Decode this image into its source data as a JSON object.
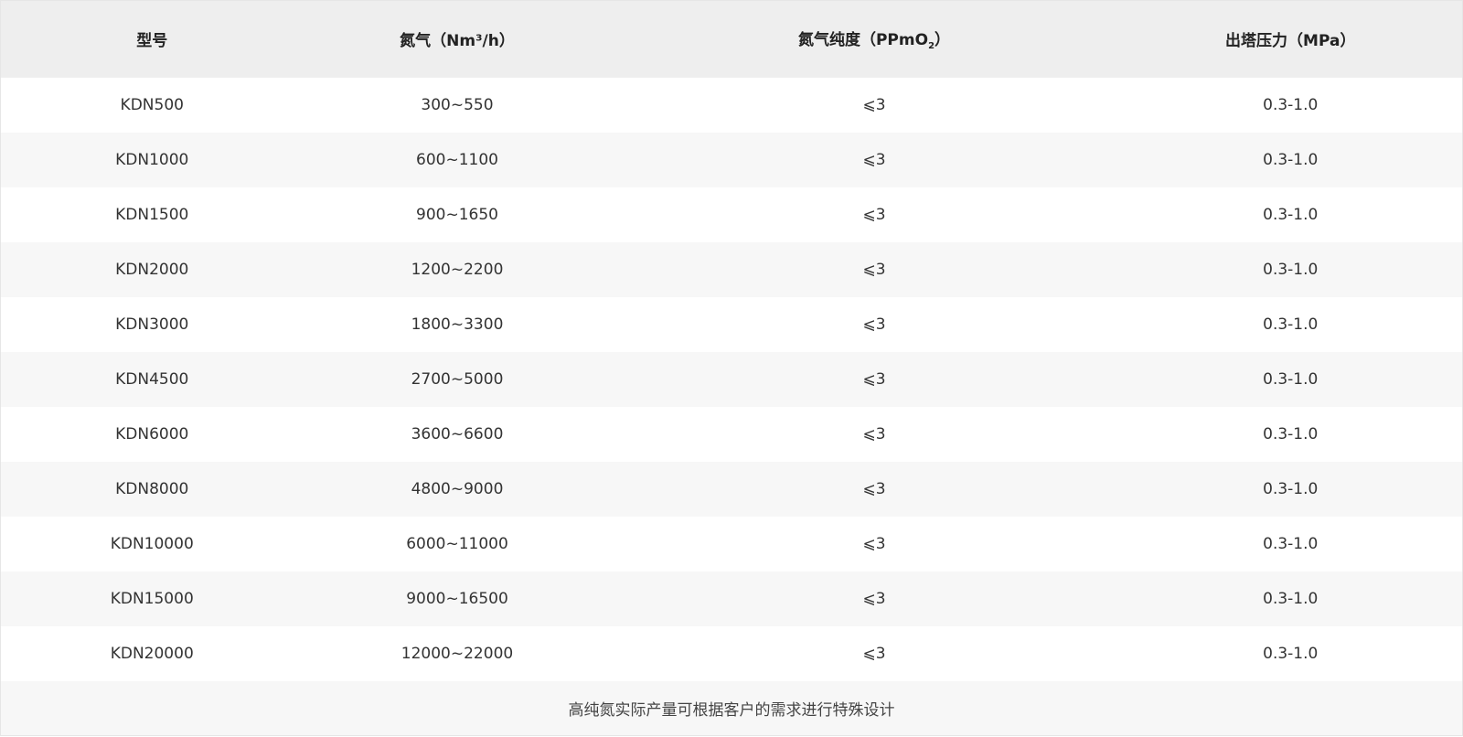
{
  "table": {
    "headers": {
      "model": "型号",
      "nitrogen": "氮气（Nm³/h）",
      "purity_prefix": "氮气纯度（PPmO",
      "purity_sub": "2",
      "purity_suffix": "）",
      "pressure": "出塔压力（MPa）"
    },
    "rows": [
      {
        "model": "KDN500",
        "flow": "300~550",
        "purity": "⩽3",
        "pressure": "0.3-1.0"
      },
      {
        "model": "KDN1000",
        "flow": "600~1100",
        "purity": "⩽3",
        "pressure": "0.3-1.0"
      },
      {
        "model": "KDN1500",
        "flow": "900~1650",
        "purity": "⩽3",
        "pressure": "0.3-1.0"
      },
      {
        "model": "KDN2000",
        "flow": "1200~2200",
        "purity": "⩽3",
        "pressure": "0.3-1.0"
      },
      {
        "model": "KDN3000",
        "flow": "1800~3300",
        "purity": "⩽3",
        "pressure": "0.3-1.0"
      },
      {
        "model": "KDN4500",
        "flow": "2700~5000",
        "purity": "⩽3",
        "pressure": "0.3-1.0"
      },
      {
        "model": "KDN6000",
        "flow": "3600~6600",
        "purity": "⩽3",
        "pressure": "0.3-1.0"
      },
      {
        "model": "KDN8000",
        "flow": "4800~9000",
        "purity": "⩽3",
        "pressure": "0.3-1.0"
      },
      {
        "model": "KDN10000",
        "flow": "6000~11000",
        "purity": "⩽3",
        "pressure": "0.3-1.0"
      },
      {
        "model": "KDN15000",
        "flow": "9000~16500",
        "purity": "⩽3",
        "pressure": "0.3-1.0"
      },
      {
        "model": "KDN20000",
        "flow": "12000~22000",
        "purity": "⩽3",
        "pressure": "0.3-1.0"
      }
    ],
    "note": "高纯氮实际产量可根据客户的需求进行特殊设计"
  }
}
